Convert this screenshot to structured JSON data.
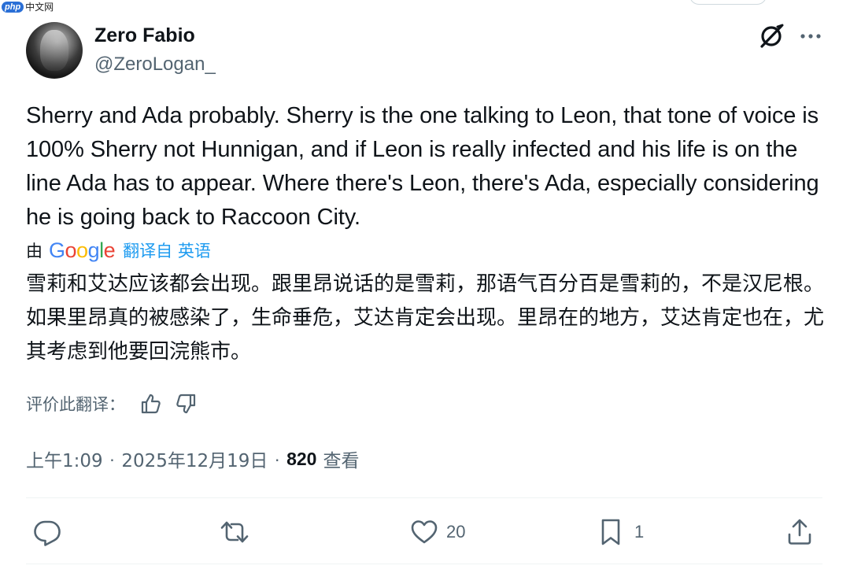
{
  "watermark": {
    "logo": "php",
    "text": "中文网"
  },
  "author": {
    "display_name": "Zero Fabio",
    "handle": "@ZeroLogan_"
  },
  "icons": {
    "avatar": "avatar",
    "grok": "grok-icon",
    "more": "more-icon",
    "reply": "reply-icon",
    "retweet": "retweet-icon",
    "like": "heart-icon",
    "bookmark": "bookmark-icon",
    "share": "share-icon",
    "thumbs_up": "thumbs-up-icon",
    "thumbs_down": "thumbs-down-icon"
  },
  "tweet": {
    "text": "Sherry and Ada probably. Sherry is the one talking to Leon, that tone of voice is 100% Sherry not Hunnigan, and if Leon is really infected and his life is on the line Ada has to appear. Where there's Leon, there's Ada, especially considering he is going back to Raccoon City."
  },
  "translation": {
    "by_label": "由",
    "provider": "Google",
    "translated_from": "翻译自 英语",
    "text": "雪莉和艾达应该都会出现。跟里昂说话的是雪莉，那语气百分百是雪莉的，不是汉尼根。如果里昂真的被感染了，生命垂危，艾达肯定会出现。里昂在的地方，艾达肯定也在，尤其考虑到他要回浣熊市。",
    "rate_label": "评价此翻译："
  },
  "meta": {
    "time": "上午1:09",
    "date": "2025年12月19日",
    "separator": "·",
    "views_count": "820",
    "views_label": "查看"
  },
  "actions": {
    "replies": "",
    "retweets": "",
    "likes": "20",
    "bookmarks": "1"
  },
  "colors": {
    "text_primary": "#0f1419",
    "text_secondary": "#536471",
    "link_blue": "#1d9bf0",
    "divider": "#eff3f4"
  }
}
